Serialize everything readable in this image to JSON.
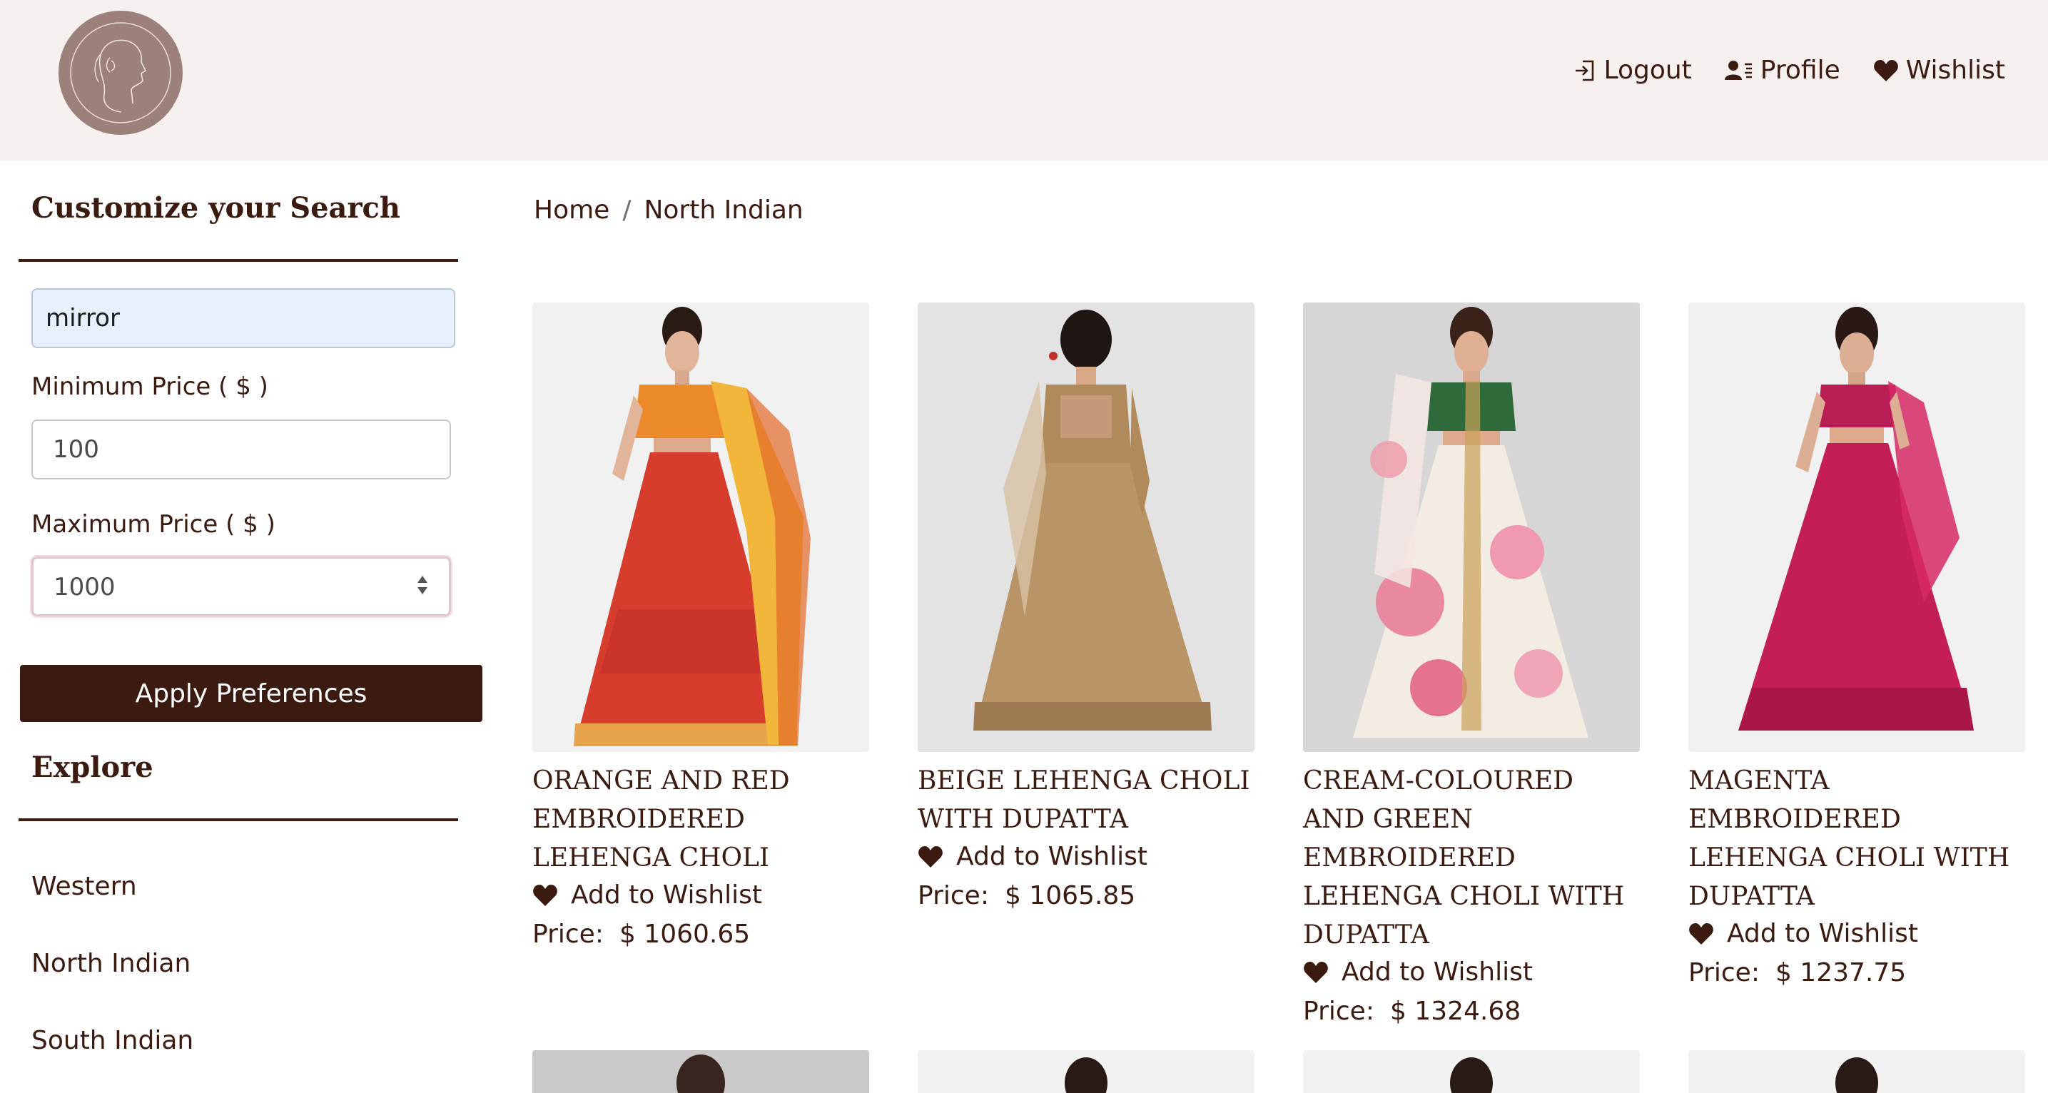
{
  "header": {
    "nav": [
      {
        "label": "Logout",
        "icon": "logout-icon"
      },
      {
        "label": "Profile",
        "icon": "profile-icon"
      },
      {
        "label": "Wishlist",
        "icon": "heart-icon"
      }
    ]
  },
  "sidebar": {
    "heading": "Customize your Search",
    "search_value": "mirror",
    "min_label": "Minimum Price ( $ )",
    "min_value": "100",
    "max_label": "Maximum Price ( $ )",
    "max_value": "1000",
    "apply_label": "Apply Preferences",
    "explore_heading": "Explore",
    "explore_items": [
      "Western",
      "North Indian",
      "South Indian"
    ]
  },
  "breadcrumb": {
    "home": "Home",
    "separator": "/",
    "current": "North Indian"
  },
  "products": [
    {
      "title": "Orange and Red Embroidered Lehenga Choli",
      "wishlist_label": "Add to Wishlist",
      "price_label": "Price:",
      "price": "$ 1060.65"
    },
    {
      "title": "Beige Lehenga Choli with Dupatta",
      "wishlist_label": "Add to Wishlist",
      "price_label": "Price:",
      "price": "$ 1065.85"
    },
    {
      "title": "Cream-Coloured and Green Embroidered Lehenga Choli with Dupatta",
      "wishlist_label": "Add to Wishlist",
      "price_label": "Price:",
      "price": "$ 1324.68"
    },
    {
      "title": "Magenta Embroidered Lehenga Choli with Dupatta",
      "wishlist_label": "Add to Wishlist",
      "price_label": "Price:",
      "price": "$ 1237.75"
    }
  ],
  "colors": {
    "brand": "#3b1a10",
    "header_bg": "#f6f0ef",
    "logo_bg": "#9b817a"
  }
}
